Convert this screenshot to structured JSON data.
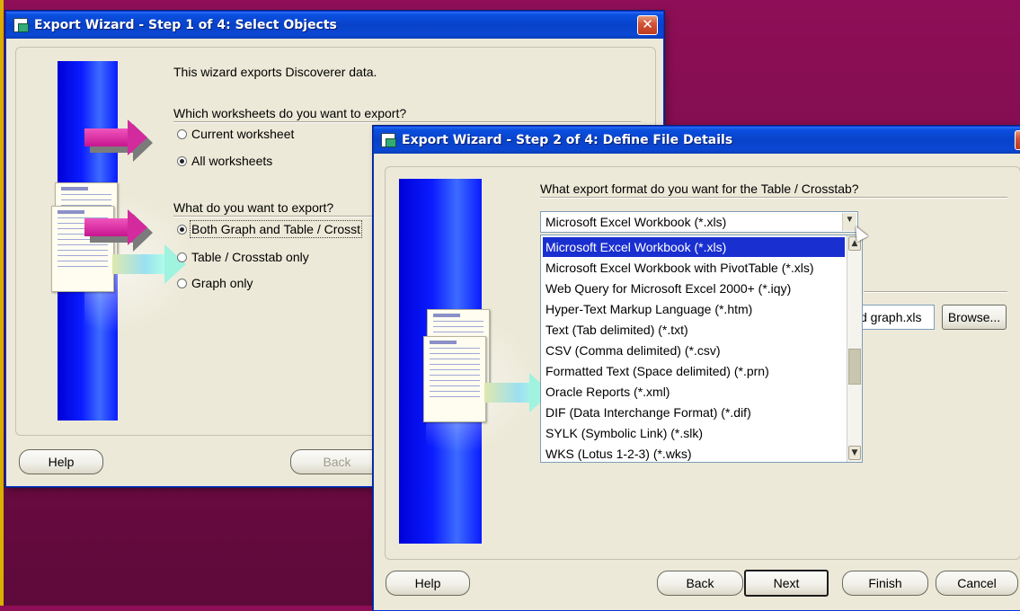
{
  "window1": {
    "title": "Export Wizard - Step 1 of 4: Select Objects",
    "intro": "This wizard exports Discoverer data.",
    "worksheets_question": "Which worksheets do you want to export?",
    "worksheets_options": [
      "Current worksheet",
      "All worksheets"
    ],
    "worksheets_selected": 1,
    "export_question": "What do you want to export?",
    "export_options": [
      "Both Graph and Table / Crosst",
      "Table / Crosstab only",
      "Graph only"
    ],
    "export_selected": 0,
    "buttons": {
      "help": "Help",
      "back": "Back"
    }
  },
  "window2": {
    "title": "Export Wizard - Step 2 of 4: Define File Details",
    "format_question": "What export format do you want for the Table / Crosstab?",
    "format_selected": "Microsoft Excel Workbook (*.xls)",
    "format_options": [
      "Microsoft Excel Workbook (*.xls)",
      "Microsoft Excel Workbook with PivotTable (*.xls)",
      "Web Query for Microsoft Excel 2000+ (*.iqy)",
      "Hyper-Text Markup Language (*.htm)",
      "Text (Tab delimited) (*.txt)",
      "CSV (Comma delimited) (*.csv)",
      "Formatted Text (Space delimited) (*.prn)",
      "Oracle Reports (*.xml)",
      "DIF (Data Interchange Format) (*.dif)",
      "SYLK (Symbolic Link) (*.slk)",
      "WKS (Lotus 1-2-3) (*.wks)"
    ],
    "highlighted_index": 0,
    "file_field_value": "d graph.xls",
    "browse_label": "Browse...",
    "buttons": {
      "help": "Help",
      "back": "Back",
      "next": "Next",
      "finish": "Finish",
      "cancel": "Cancel"
    }
  },
  "icons": {
    "close": "close-x-icon",
    "window_icon": "wizard-window-icon",
    "dropdown_arrow": "chevron-down-icon",
    "scroll_up": "scroll-up-arrow-icon",
    "scroll_down": "scroll-down-arrow-icon",
    "pointer": "mouse-pointer-icon",
    "callout_arrow": "pink-arrow-icon"
  },
  "colors": {
    "title_bar": "#0a4fe0",
    "selection": "#1a2fd0",
    "callout_arrow": "#d32a9e",
    "slide_background": "#7a0b4a"
  }
}
